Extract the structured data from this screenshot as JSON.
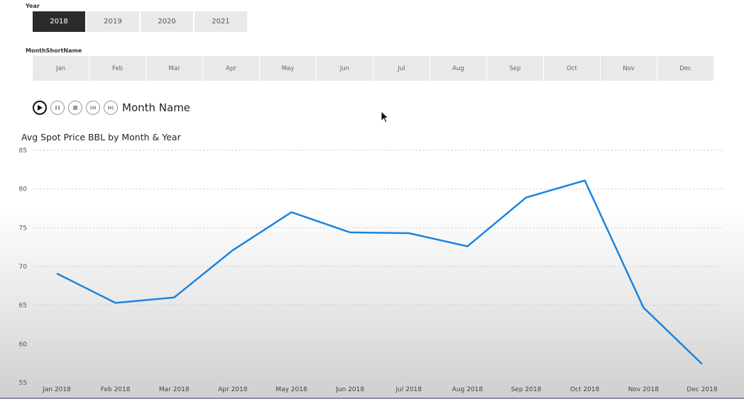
{
  "slicers": {
    "year": {
      "label": "Year",
      "options": [
        "2018",
        "2019",
        "2020",
        "2021"
      ],
      "selected": "2018"
    },
    "month": {
      "label": "MonthShortName",
      "options": [
        "Jan",
        "Feb",
        "Mar",
        "Apr",
        "May",
        "Jun",
        "Jul",
        "Aug",
        "Sep",
        "Oct",
        "Nov",
        "Dec"
      ]
    }
  },
  "play_axis": {
    "title": "Month Name",
    "buttons": [
      "play-icon",
      "pause-icon",
      "stop-icon",
      "previous-icon",
      "next-icon"
    ],
    "active_button": "play-icon"
  },
  "chart_data": {
    "type": "line",
    "title": "Avg Spot Price BBL by Month & Year",
    "categories": [
      "Jan 2018",
      "Feb 2018",
      "Mar 2018",
      "Apr 2018",
      "May 2018",
      "Jun 2018",
      "Jul 2018",
      "Aug 2018",
      "Sep 2018",
      "Oct 2018",
      "Nov 2018",
      "Dec 2018"
    ],
    "series": [
      {
        "values": [
          69.1,
          65.3,
          66.0,
          72.1,
          77.0,
          74.4,
          74.3,
          72.6,
          78.9,
          81.1,
          64.7,
          57.4
        ],
        "color": "#1a84e0"
      }
    ],
    "yticks": [
      55,
      60,
      65,
      70,
      75,
      80,
      85
    ],
    "ylim": [
      55,
      85
    ],
    "grid": "horizontal-dotted",
    "legend": "none"
  }
}
